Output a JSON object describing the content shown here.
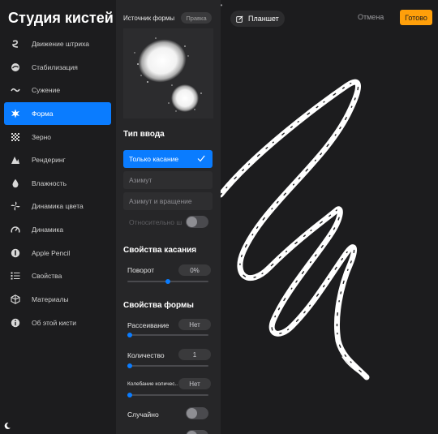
{
  "app": {
    "title": "Студия кистей"
  },
  "sidebar": {
    "items": [
      {
        "label": "Движение штриха",
        "icon": "stroke-path-icon",
        "active": false
      },
      {
        "label": "Стабилизация",
        "icon": "stabilization-icon",
        "active": false
      },
      {
        "label": "Сужение",
        "icon": "taper-icon",
        "active": false
      },
      {
        "label": "Форма",
        "icon": "shape-icon",
        "active": true
      },
      {
        "label": "Зерно",
        "icon": "grain-icon",
        "active": false
      },
      {
        "label": "Рендеринг",
        "icon": "rendering-icon",
        "active": false
      },
      {
        "label": "Влажность",
        "icon": "wet-mix-icon",
        "active": false
      },
      {
        "label": "Динамика цвета",
        "icon": "color-dynamics-icon",
        "active": false
      },
      {
        "label": "Динамика",
        "icon": "dynamics-icon",
        "active": false
      },
      {
        "label": "Apple Pencil",
        "icon": "apple-pencil-icon",
        "active": false
      },
      {
        "label": "Свойства",
        "icon": "properties-icon",
        "active": false
      },
      {
        "label": "Материалы",
        "icon": "materials-icon",
        "active": false
      },
      {
        "label": "Об этой кисти",
        "icon": "info-icon",
        "active": false
      }
    ]
  },
  "panel": {
    "source_label": "Источник формы",
    "edit_label": "Правка",
    "input_type": {
      "title": "Тип ввода",
      "options": [
        {
          "label": "Только касание",
          "selected": true
        },
        {
          "label": "Азимут",
          "selected": false
        },
        {
          "label": "Азимут и вращение",
          "selected": false
        }
      ],
      "relative_label": "Относительно ш",
      "relative_on": false
    },
    "touch": {
      "title": "Свойства касания",
      "rotation_label": "Поворот",
      "rotation_value": "0%",
      "rotation_level": 0.5
    },
    "shape": {
      "title": "Свойства формы",
      "scatter_label": "Рассеивание",
      "scatter_value": "Нет",
      "scatter_level": 0,
      "count_label": "Количество",
      "count_value": "1",
      "count_level": 0,
      "jitter_label": "Колебание количес..",
      "jitter_value": "Нет",
      "jitter_level": 0,
      "random_label": "Случайно",
      "random_on": false
    }
  },
  "canvas": {
    "pad_label": "Планшет",
    "cancel_label": "Отмена",
    "done_label": "Готово",
    "accent_color": "#ff9f0a",
    "selection_color": "#0a7cff"
  }
}
